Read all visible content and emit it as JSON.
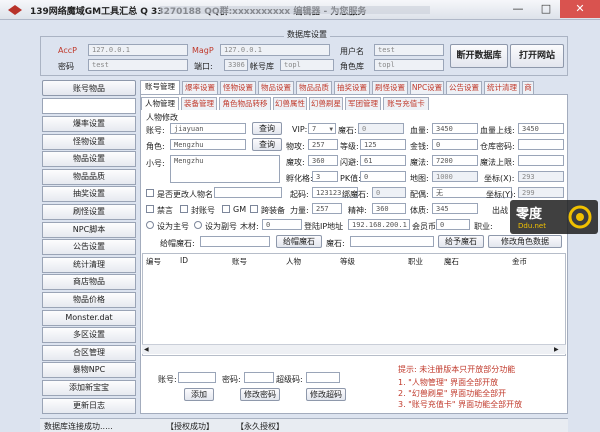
{
  "window": {
    "title": "139网络魔域GM工具汇总 Q 33270188 QQ群:xxxxxxxxxx 编辑器 - 为您服务",
    "min": "—",
    "max": "□",
    "close": "✕"
  },
  "db": {
    "group_title": "数据库设置",
    "acc_p_label": "AccP",
    "acc_p_value": "127.0.0.1",
    "pwd_label": "密码",
    "pwd_value": "test",
    "mag_p_label": "MagP",
    "mag_p_value": "127.0.0.1",
    "port_label": "端口:",
    "port_value": "3306",
    "account_db_label": "帐号库",
    "account_db_value": "topl",
    "user_label": "用户名",
    "user_value": "test",
    "role_db_label": "角色库",
    "role_db_value": "topl",
    "disconnect_label": "断开数据库",
    "open_site_label": "打开网站"
  },
  "sidebar": {
    "header": "账号物品",
    "items": [
      "爆率设置",
      "怪物设置",
      "物品设置",
      "物品品质",
      "抽奖设置",
      "刷怪设置",
      "NPC脚本",
      "公告设置",
      "统计清理",
      "商店物品",
      "物品价格",
      "Monster.dat",
      "多区设置",
      "合区管理",
      "暴物NPC",
      "添加新宝宝",
      "更新日志"
    ]
  },
  "tabs": [
    "账号管理",
    "爆率设置",
    "怪物设置",
    "物品设置",
    "物品品质",
    "抽奖设置",
    "刷怪设置",
    "NPC设置",
    "公告设置",
    "统计清理",
    "商"
  ],
  "subtabs": [
    "人物管理",
    "装备管理",
    "角色物品转移",
    "幻兽属性",
    "幻兽刷星",
    "军团管理",
    "账号充值卡"
  ],
  "char": {
    "section": "人物修改",
    "account_label": "账号:",
    "account_value": "jiayuan",
    "query1": "查询",
    "vip_label": "VIP:",
    "vip_value": "7",
    "magic_stone_label": "魔石:",
    "magic_stone_value": "0",
    "hp_label": "血量:",
    "hp_value": "3450",
    "hp_max_label": "血量上线:",
    "hp_max_value": "3450",
    "role_label": "角色:",
    "role_value": "Mengzhu",
    "query2": "查询",
    "attack_label": "物攻:",
    "attack_value": "257",
    "level_label": "等级:",
    "level_value": "125",
    "gold_label": "金钱:",
    "gold_value": "0",
    "wh_pwd_label": "仓库密码:",
    "wh_pwd_value": "",
    "nick_label": "小号:",
    "nick_value": "Mengzhu",
    "mattack_label": "魔攻:",
    "mattack_value": "360",
    "dodge_label": "闪避:",
    "dodge_value": "61",
    "mp_label": "魔法:",
    "mp_value": "7200",
    "mp_max_label": "魔法上限:",
    "mp_max_value": "",
    "hatch_label": "孵化格:",
    "hatch_value": "3",
    "pk_label": "PK值:",
    "pk_value": "0",
    "map_label": "地图:",
    "map_value": "1000",
    "coord_x_label": "坐标(X):",
    "coord_x_value": "293",
    "rename_label": "是否更改人物名",
    "start_label": "起码:",
    "start_value": "123123",
    "lock_stone_label": "绑魔石:",
    "lock_stone_value": "0",
    "spouse_label": "配偶:",
    "spouse_value": "无",
    "coord_y_label": "坐标(Y):",
    "coord_y_value": "299",
    "ban_label": "禁言",
    "sealacct_label": "封账号",
    "gm_label": "GM",
    "gm_equip_label": "跨装备",
    "power_label": "力量:",
    "power_value": "257",
    "spirit_label": "精神:",
    "spirit_value": "360",
    "body_label": "体质:",
    "body_value": "345",
    "out_label": "出战",
    "main_label": "设为主号",
    "sub_label": "设为副号",
    "wood_label": "木材:",
    "wood_value": "0",
    "login_ip_label": "登陆IP地址",
    "login_ip_value": "192.168.200.1",
    "member_label": "会员币",
    "member_value": "0",
    "job_label": "职业:",
    "give_stone_label": "给帽魔石:",
    "give_stone_value": "",
    "give_stone_btn": "给帽魔石",
    "give_stone2_label": "魔石:",
    "give_stone2_value": "",
    "give_stone2_btn": "给予魔石",
    "modify_role_btn": "修改角色数据"
  },
  "table": {
    "headers": [
      "编号",
      "ID",
      "账号",
      "人物",
      "等级",
      "职业",
      "魔石",
      "金币"
    ]
  },
  "bottom": {
    "account_label": "账号:",
    "account_value": "",
    "pwd_label": "密码:",
    "pwd_value": "",
    "super_pwd_label": "超级码:",
    "super_pwd_value": "",
    "add_btn": "添加",
    "modify_pwd_btn": "修改密码",
    "modify_super_btn": "修改超码",
    "tip_title": "提示: 未注册版本只开放部分功能",
    "tips": [
      "1. \"人物管理\" 界面全部开放",
      "2. \"幻兽刷星\" 界面功能全部开",
      "3. \"账号充值卡\" 界面功能全部开放"
    ]
  },
  "statusbar": {
    "left": "数据库连接成功.....",
    "mid": "【授权成功】",
    "right": "【永久授权】"
  },
  "watermark": {
    "text": "零度",
    "sub": "Ddu.net"
  }
}
